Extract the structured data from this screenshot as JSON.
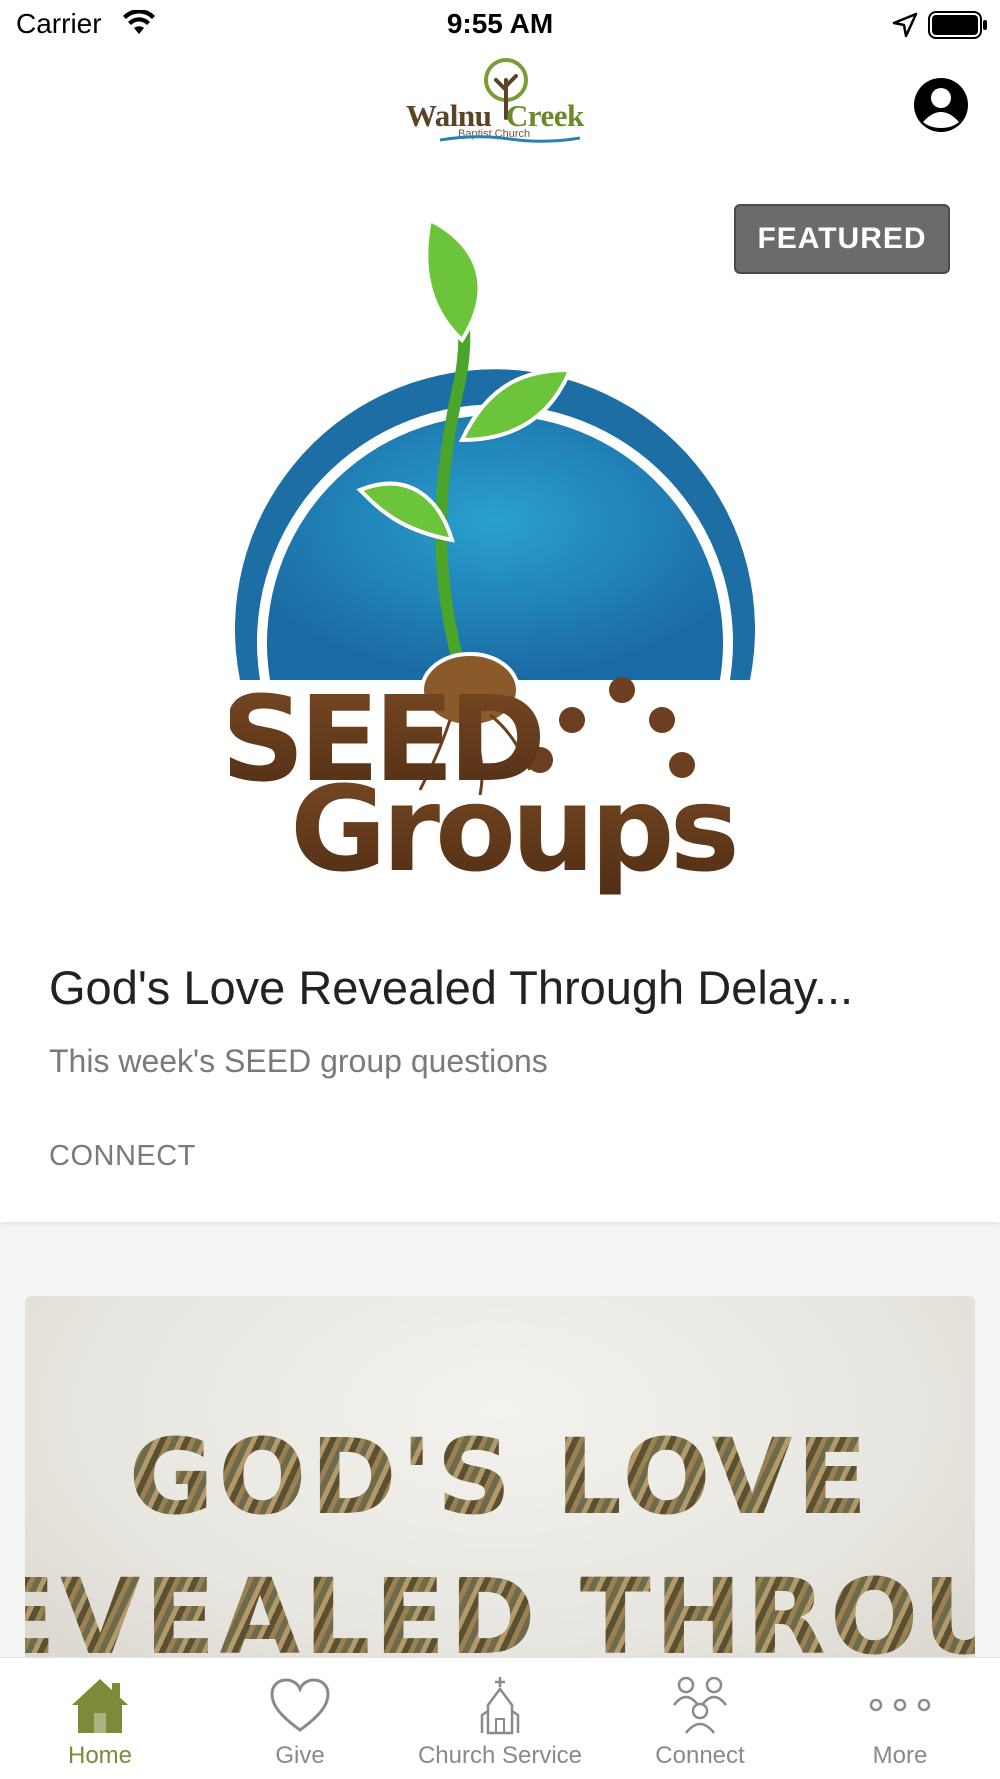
{
  "status_bar": {
    "carrier": "Carrier",
    "time": "9:55 AM"
  },
  "header": {
    "logo_name_part1": "Walnu",
    "logo_name_part2": "Creek",
    "logo_subtitle": "Baptist Church",
    "profile_icon": "user-circle-icon"
  },
  "featured": {
    "badge": "FEATURED",
    "image_text_line1": "SEED",
    "image_text_line2": "Groups",
    "title": "God's Love Revealed Through Delay...",
    "subtitle": "This week's SEED group questions",
    "category": "CONNECT"
  },
  "second_card": {
    "line1": "GOD'S LOVE",
    "line2": "EVEALED THROUG"
  },
  "tabs": [
    {
      "label": "Home",
      "icon": "home-icon",
      "active": true
    },
    {
      "label": "Give",
      "icon": "heart-icon",
      "active": false
    },
    {
      "label": "Church Service",
      "icon": "church-icon",
      "active": false
    },
    {
      "label": "Connect",
      "icon": "people-icon",
      "active": false
    },
    {
      "label": "More",
      "icon": "more-dots-icon",
      "active": false
    }
  ],
  "colors": {
    "accent": "#7e8a3a",
    "badge_bg": "#6b6b6b",
    "seed_blue": "#1f6fa8",
    "seed_brown": "#6b3f1f",
    "leaf_green": "#5cbf2a"
  }
}
